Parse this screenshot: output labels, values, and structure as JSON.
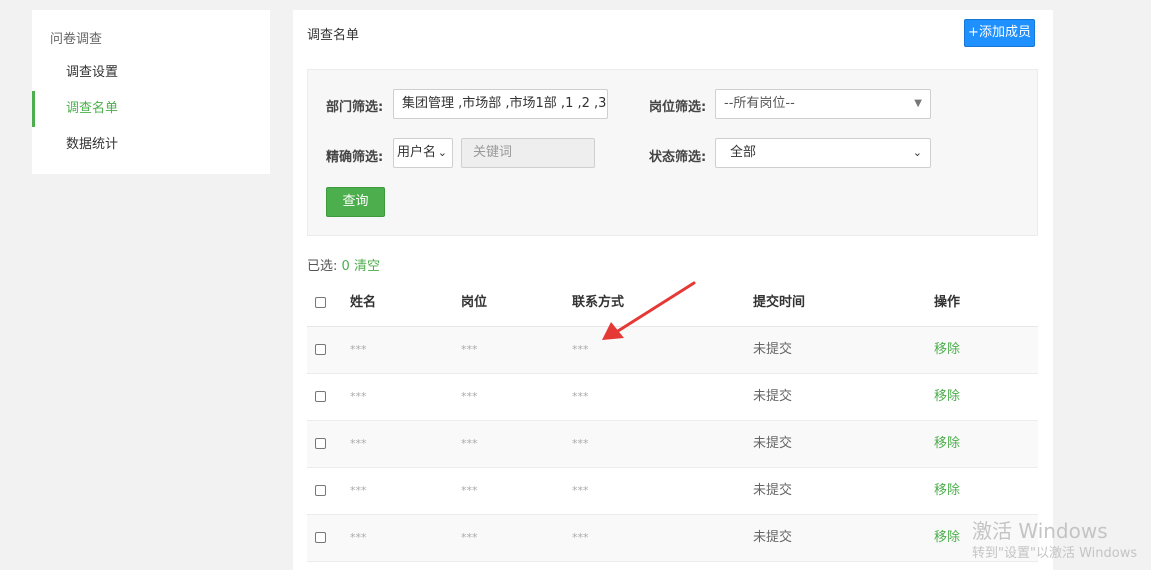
{
  "sidebar": {
    "title": "问卷调查",
    "items": [
      {
        "label": "调查设置"
      },
      {
        "label": "调查名单"
      },
      {
        "label": "数据统计"
      }
    ]
  },
  "main": {
    "title": "调查名单",
    "add_button": "+添加成员"
  },
  "filter": {
    "dept_label": "部门筛选:",
    "dept_value": "集团管理 ,市场部 ,市场1部 ,1 ,2 ,3",
    "position_label": "岗位筛选:",
    "position_value": "--所有岗位--",
    "exact_label": "精确筛选:",
    "exact_field": "用户名",
    "keyword_placeholder": "关键词",
    "status_label": "状态筛选:",
    "status_value": "全部",
    "query_button": "查询"
  },
  "selection": {
    "label": "已选:",
    "count": "0",
    "clear": "清空"
  },
  "table": {
    "headers": [
      "姓名",
      "岗位",
      "联系方式",
      "提交时间",
      "操作"
    ],
    "rows": [
      {
        "name": "***",
        "position": "***",
        "contact": "***",
        "time": "未提交",
        "action": "移除"
      },
      {
        "name": "***",
        "position": "***",
        "contact": "***",
        "time": "未提交",
        "action": "移除"
      },
      {
        "name": "***",
        "position": "***",
        "contact": "***",
        "time": "未提交",
        "action": "移除"
      },
      {
        "name": "***",
        "position": "***",
        "contact": "***",
        "time": "未提交",
        "action": "移除"
      },
      {
        "name": "***",
        "position": "***",
        "contact": "***",
        "time": "未提交",
        "action": "移除"
      }
    ]
  },
  "watermark": {
    "line1": "激活 Windows",
    "line2": "转到\"设置\"以激活 Windows"
  },
  "colors": {
    "accent_green": "#4cae4c",
    "primary_blue": "#1e90ff",
    "annotation_red": "#e53935"
  }
}
